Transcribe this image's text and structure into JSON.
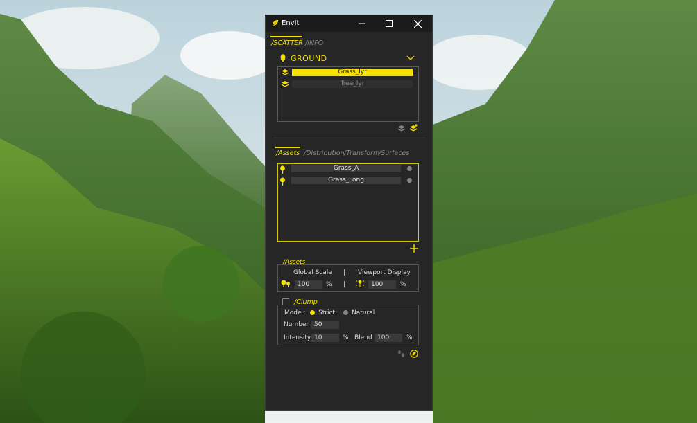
{
  "window": {
    "title": "EnvIt",
    "accent": "#f5e000"
  },
  "top_tabs": {
    "scatter": "/SCATTER",
    "info": "/INFO"
  },
  "ground": {
    "label": "GROUND",
    "layers": [
      {
        "label": "Grass_lyr",
        "selected": true
      },
      {
        "label": "Tree_lyr",
        "selected": false
      }
    ]
  },
  "sub_tabs": {
    "assets": "/Assets",
    "distribution": "/Distribution",
    "transform": "/Transform",
    "surfaces": "/Surfaces"
  },
  "assets_list": [
    {
      "label": "Grass_A"
    },
    {
      "label": "Grass_Long"
    }
  ],
  "assets_settings": {
    "header": "/Assets",
    "global_scale_label": "Global Scale",
    "viewport_display_label": "Viewport Display",
    "divider": "|",
    "global_scale_value": "100",
    "viewport_display_value": "100",
    "percent": "%"
  },
  "clump": {
    "header": "/Clump",
    "checked": false,
    "mode_label": "Mode :",
    "mode_options": [
      "Strict",
      "Natural"
    ],
    "mode_selected": "Strict",
    "number_label": "Number :",
    "number_value": "50",
    "intensity_label": "Intensity :",
    "intensity_value": "10",
    "blend_label": "Blend :",
    "blend_value": "100",
    "percent": "%"
  }
}
